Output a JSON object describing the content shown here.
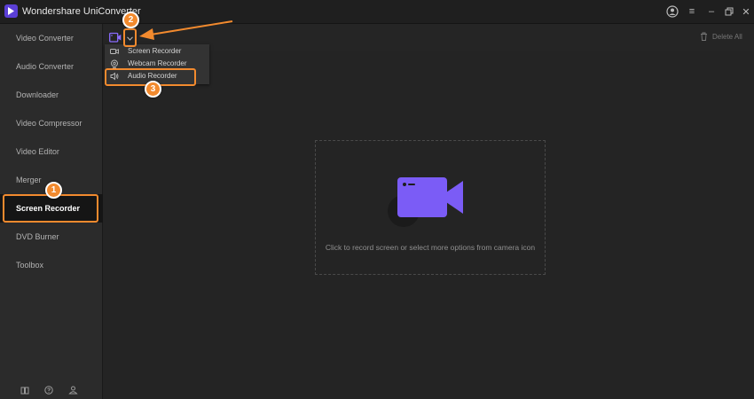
{
  "app": {
    "title": "Wondershare UniConverter"
  },
  "sidebar": {
    "items": [
      {
        "label": "Video Converter"
      },
      {
        "label": "Audio Converter"
      },
      {
        "label": "Downloader"
      },
      {
        "label": "Video Compressor"
      },
      {
        "label": "Video Editor"
      },
      {
        "label": "Merger"
      },
      {
        "label": "Screen Recorder",
        "active": true
      },
      {
        "label": "DVD Burner"
      },
      {
        "label": "Toolbox"
      }
    ],
    "bottom_icons": [
      "book-icon",
      "help-icon",
      "user-group-icon"
    ]
  },
  "toolbar": {
    "delete_all_label": "Delete All"
  },
  "menu": {
    "items": [
      {
        "label": "Screen Recorder",
        "icon": "video-camera-icon"
      },
      {
        "label": "Webcam Recorder",
        "icon": "webcam-icon"
      },
      {
        "label": "Audio Recorder",
        "icon": "speaker-icon"
      }
    ]
  },
  "main": {
    "hint": "Click to record screen or select more options from camera icon"
  },
  "annotations": {
    "steps": [
      "1",
      "2",
      "3"
    ]
  },
  "colors": {
    "accent": "#7a5cf5",
    "highlight": "#f28a2e",
    "background": "#242424",
    "sidebar": "#2b2b2b"
  }
}
